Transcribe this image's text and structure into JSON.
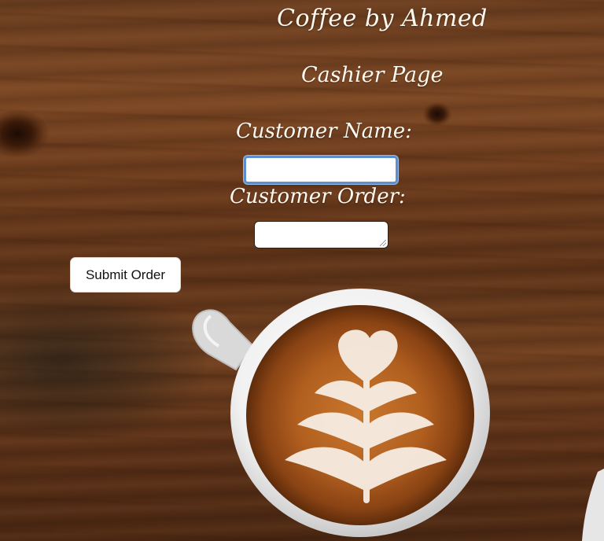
{
  "header": {
    "site_title": "Coffee by Ahmed",
    "page_title": "Cashier Page"
  },
  "form": {
    "customer_name_label": "Customer Name:",
    "customer_name_value": "",
    "customer_order_label": "Customer Order:",
    "customer_order_value": "",
    "submit_label": "Submit Order"
  },
  "colors": {
    "heading_text": "#fdf8f0",
    "focus_ring": "#5b8fd0",
    "wood": "#6a3d1f"
  }
}
